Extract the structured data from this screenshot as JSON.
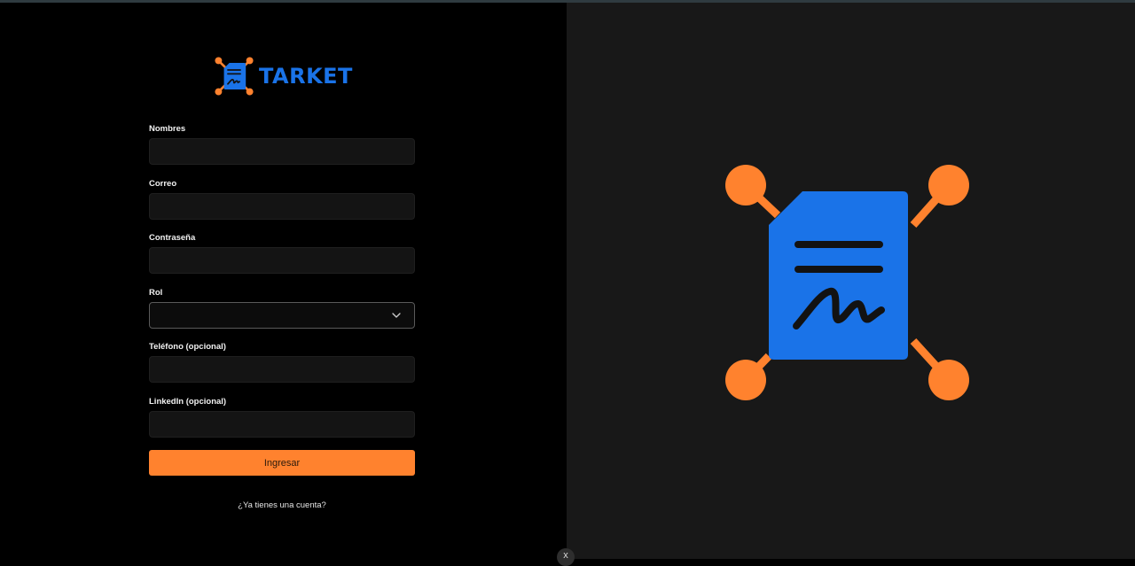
{
  "brand": {
    "name": "TARKET",
    "logo_icon": "signed-document-network-icon",
    "color": "#1a73e8",
    "accent": "#ff822e"
  },
  "form": {
    "fields": [
      {
        "label": "Nombres",
        "value": "",
        "placeholder": ""
      },
      {
        "label": "Correo",
        "value": "",
        "placeholder": ""
      },
      {
        "label": "Contraseña",
        "value": "",
        "placeholder": ""
      },
      {
        "label": "Rol",
        "value": "",
        "icon": "chevron-down-icon"
      },
      {
        "label": "Teléfono (opcional)",
        "value": "",
        "placeholder": ""
      },
      {
        "label": "LinkedIn (opcional)",
        "value": "",
        "placeholder": ""
      }
    ],
    "submit_label": "Ingresar",
    "submit_color": "#ff822e",
    "login_link": "¿Ya tienes una cuenta?"
  },
  "hero": {
    "icon": "signed-document-network-icon"
  },
  "overlay": {
    "close_glyph": "x"
  }
}
